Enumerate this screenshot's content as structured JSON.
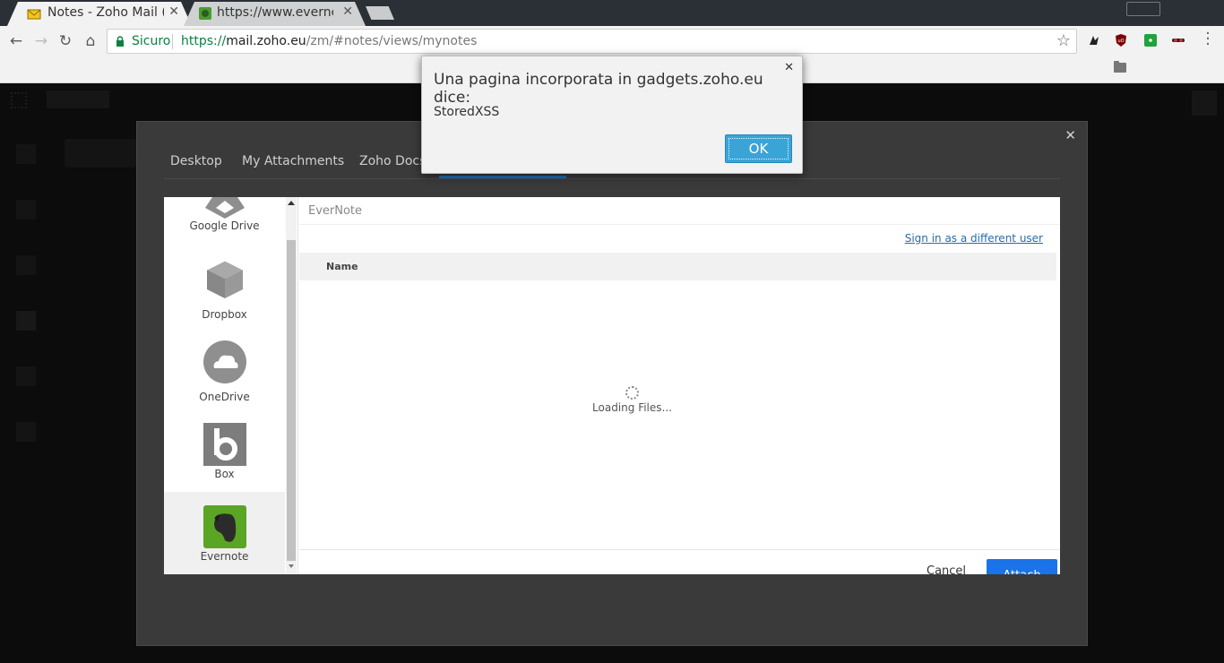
{
  "browser": {
    "tabs": [
      {
        "title": "Notes - Zoho Mail (",
        "title_fade": "I",
        "active": true
      },
      {
        "title": "https://www.everne",
        "active": false
      }
    ],
    "secure_label": "Sicuro",
    "url": {
      "proto": "https://",
      "host": "mail.zoho.eu",
      "path": "/zm/#notes/views/mynotes"
    }
  },
  "attach_dialog": {
    "tabs": [
      "Desktop",
      "My Attachments",
      "Zoho Docs"
    ],
    "services": [
      {
        "label": "Google Drive",
        "icon": "google-drive-icon"
      },
      {
        "label": "Dropbox",
        "icon": "dropbox-icon"
      },
      {
        "label": "OneDrive",
        "icon": "onedrive-icon"
      },
      {
        "label": "Box",
        "icon": "box-icon"
      },
      {
        "label": "Evernote",
        "icon": "evernote-icon",
        "selected": true
      }
    ],
    "breadcrumb": "EverNote",
    "sign_in_link": "Sign in as a different user",
    "column_name": "Name",
    "loading_text": "Loading Files...",
    "cancel_label": "Cancel",
    "attach_label": "Attach"
  },
  "alert": {
    "title": "Una pagina incorporata in gadgets.zoho.eu dice:",
    "message": "StoredXSS",
    "ok_label": "OK"
  },
  "colors": {
    "accent": "#1a73e8",
    "ok_button": "#3aa4d6",
    "secure": "#0b8043",
    "evernote": "#5ba525"
  }
}
